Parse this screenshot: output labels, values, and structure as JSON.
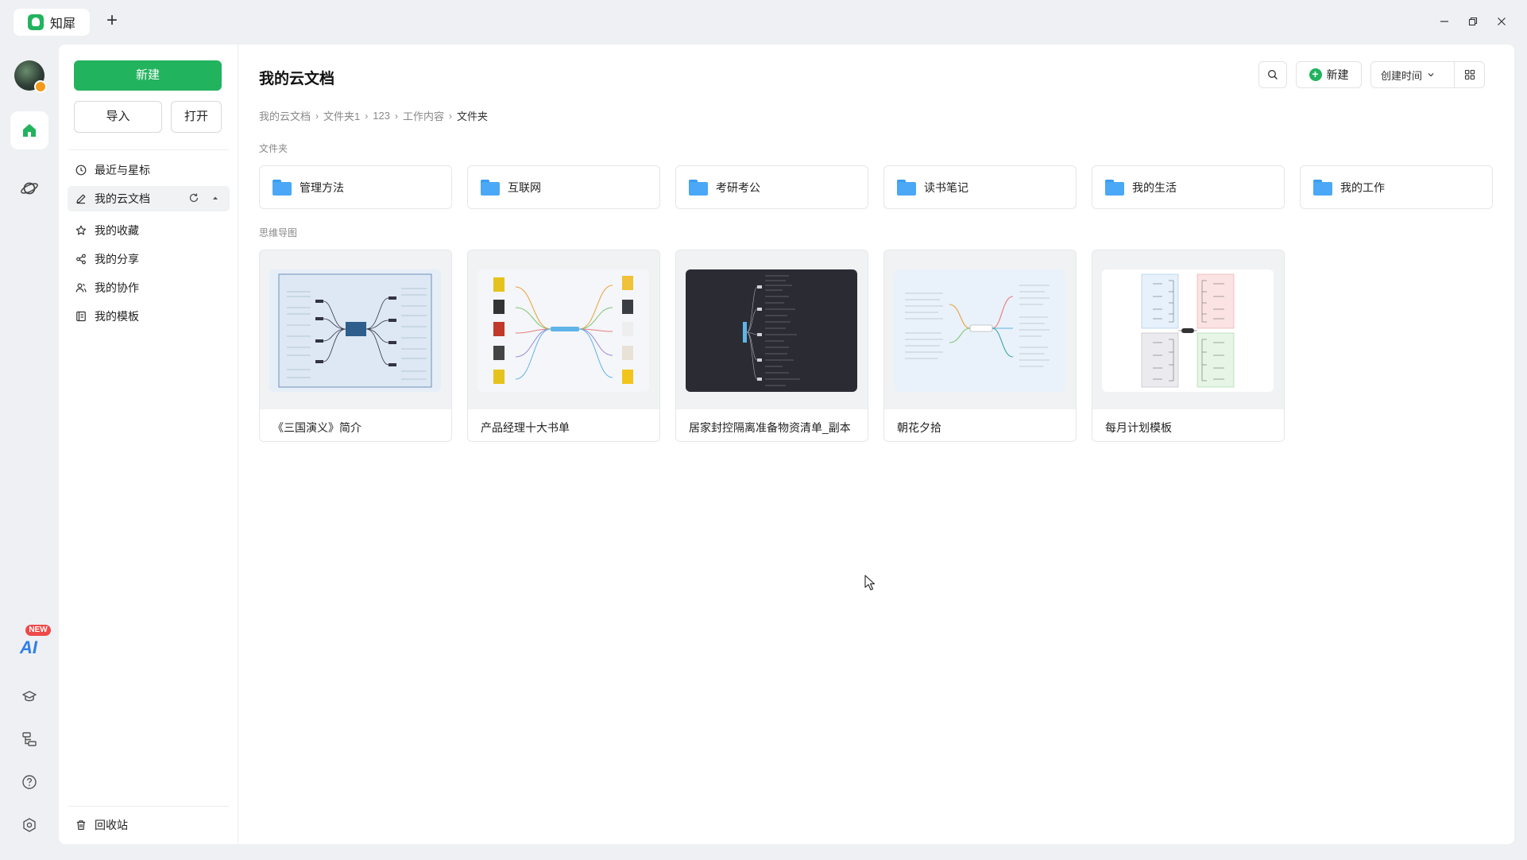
{
  "app": {
    "tab_title": "知犀"
  },
  "sidebar": {
    "new_button": "新建",
    "import_button": "导入",
    "open_button": "打开",
    "nav": [
      {
        "label": "最近与星标",
        "icon": "clock-icon"
      },
      {
        "label": "我的云文档",
        "icon": "edit-icon"
      },
      {
        "label": "我的收藏",
        "icon": "star-icon"
      },
      {
        "label": "我的分享",
        "icon": "share-icon"
      },
      {
        "label": "我的协作",
        "icon": "users-icon"
      },
      {
        "label": "我的模板",
        "icon": "template-icon"
      }
    ],
    "trash": "回收站"
  },
  "rail": {
    "ai_badge": "NEW",
    "ai_label": "AI"
  },
  "main": {
    "title": "我的云文档",
    "new_button": "新建",
    "sort_label": "创建时间",
    "breadcrumb": [
      "我的云文档",
      "文件夹1",
      "123",
      "工作内容",
      "文件夹"
    ],
    "folders_label": "文件夹",
    "folders": [
      "管理方法",
      "互联网",
      "考研考公",
      "读书笔记",
      "我的生活",
      "我的工作"
    ],
    "maps_label": "思维导图",
    "maps": [
      "《三国演义》简介",
      "产品经理十大书单",
      "居家封控隔离准备物资清单_副本",
      "朝花夕拾",
      "每月计划模板"
    ]
  },
  "colors": {
    "accent": "#22b35e",
    "folder": "#4aa8f7",
    "ai": "#2f7fe8",
    "badge": "#ee4a48"
  }
}
